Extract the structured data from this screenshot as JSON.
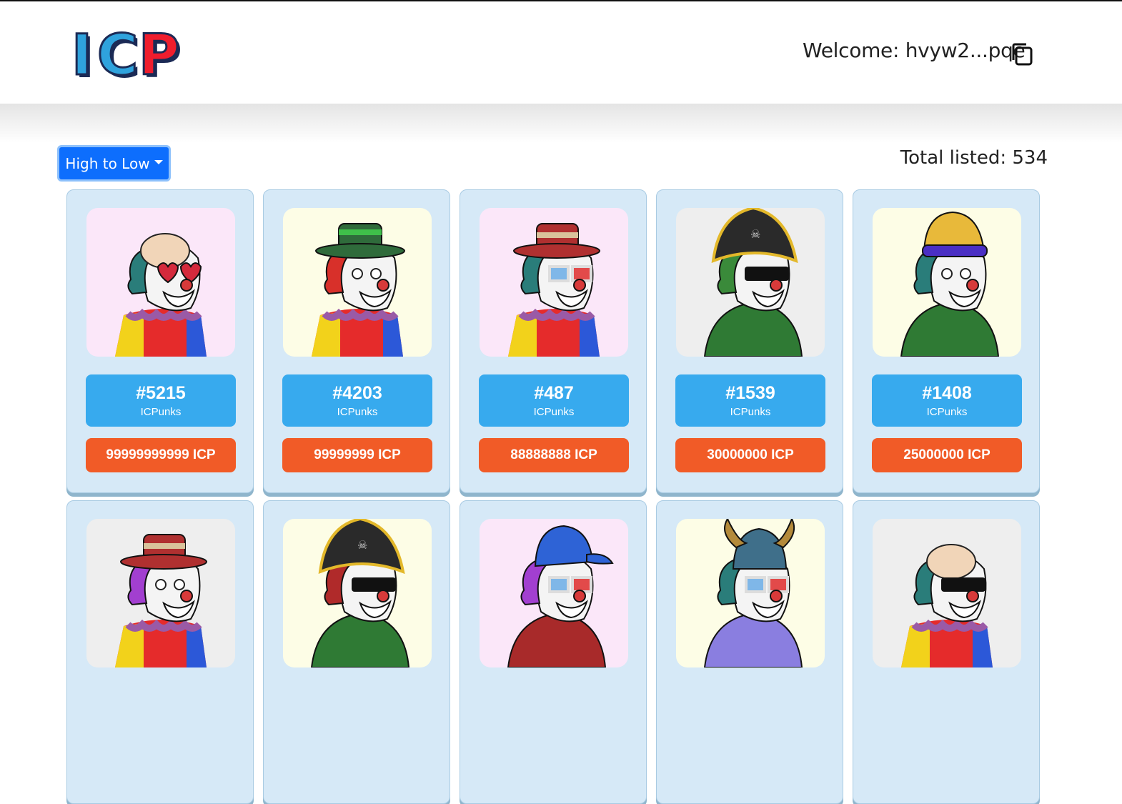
{
  "header": {
    "logo_text": "ICP",
    "welcome": "Welcome: hvyw2...pqe"
  },
  "toolbar": {
    "sort_label": "High to Low",
    "total_listed": "Total listed: 534"
  },
  "colors": {
    "accent_blue": "#37aaee",
    "price_orange": "#f15b27",
    "card_bg": "#d6e9f7",
    "button_blue": "#0d6efd"
  },
  "cards": [
    {
      "id": "#5215",
      "collection": "ICPunks",
      "price": "99999999999 ICP",
      "bg": "#fbe7f9",
      "hat": "none",
      "hair": "#2a7d7a",
      "eyes": "heart",
      "body": "clown"
    },
    {
      "id": "#4203",
      "collection": "ICPunks",
      "price": "99999999 ICP",
      "bg": "#fdfde6",
      "hat": "green",
      "hair": "#d8302a",
      "eyes": "none",
      "body": "clown"
    },
    {
      "id": "#487",
      "collection": "ICPunks",
      "price": "88888888 ICP",
      "bg": "#fbe7f9",
      "hat": "red",
      "hair": "#2a7d7a",
      "eyes": "3d",
      "body": "clown"
    },
    {
      "id": "#1539",
      "collection": "ICPunks",
      "price": "30000000 ICP",
      "bg": "#eeeeee",
      "hat": "pirate",
      "hair": "#3a8a3a",
      "eyes": "shades",
      "body": "green"
    },
    {
      "id": "#1408",
      "collection": "ICPunks",
      "price": "25000000 ICP",
      "bg": "#fdfde6",
      "hat": "beanie",
      "hair": "#2a7d7a",
      "eyes": "none",
      "body": "green"
    },
    {
      "id": "",
      "collection": "",
      "price": "",
      "bg": "#eeeeee",
      "hat": "red",
      "hair": "#a23fd0",
      "eyes": "none",
      "body": "clown"
    },
    {
      "id": "",
      "collection": "",
      "price": "",
      "bg": "#fdfde6",
      "hat": "pirate",
      "hair": "#b02a2a",
      "eyes": "shades",
      "body": "green"
    },
    {
      "id": "",
      "collection": "",
      "price": "",
      "bg": "#fbe7f9",
      "hat": "cap",
      "hair": "#a23fd0",
      "eyes": "3d",
      "body": "maroon"
    },
    {
      "id": "",
      "collection": "",
      "price": "",
      "bg": "#fdfde6",
      "hat": "viking",
      "hair": "#2a7d7a",
      "eyes": "3d",
      "body": "purple"
    },
    {
      "id": "",
      "collection": "",
      "price": "",
      "bg": "#eeeeee",
      "hat": "none",
      "hair": "#2a7d7a",
      "eyes": "shades",
      "body": "clown"
    }
  ]
}
